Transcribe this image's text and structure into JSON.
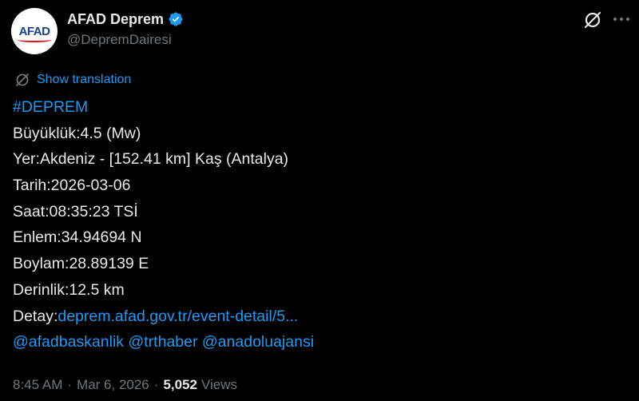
{
  "author": {
    "display_name": "AFAD Deprem",
    "handle": "@DepremDairesi",
    "avatar_text": "AFAD",
    "verified": true
  },
  "icons": {
    "verified": "verified-badge-icon",
    "grok": "grok-icon",
    "more": "more-icon",
    "translate": "translate-icon"
  },
  "translation": {
    "label": "Show translation"
  },
  "tweet_body": {
    "hashtag": "#DEPREM",
    "magnitude": "Büyüklük:4.5 (Mw)",
    "location": "Yer:Akdeniz - [152.41 km] Kaş (Antalya)",
    "date": "Tarih:2026-03-06",
    "time": "Saat:08:35:23 TSİ",
    "latitude": "Enlem:34.94694 N",
    "longitude": "Boylam:28.89139 E",
    "depth": "Derinlik:12.5 km",
    "detail_prefix": "Detay:",
    "detail_link": "deprem.afad.gov.tr/event-detail/5...",
    "mentions": [
      "@afadbaskanlik",
      "@trthaber",
      "@anadoluajansi"
    ]
  },
  "meta": {
    "time": "8:45 AM",
    "separator": "·",
    "date": "Mar 6, 2026",
    "views_count": "5,052",
    "views_label": "Views"
  },
  "colors": {
    "background": "#000000",
    "text": "#e7e9ea",
    "secondary": "#71767b",
    "link": "#1d9bf0",
    "verified": "#1d9bf0"
  }
}
